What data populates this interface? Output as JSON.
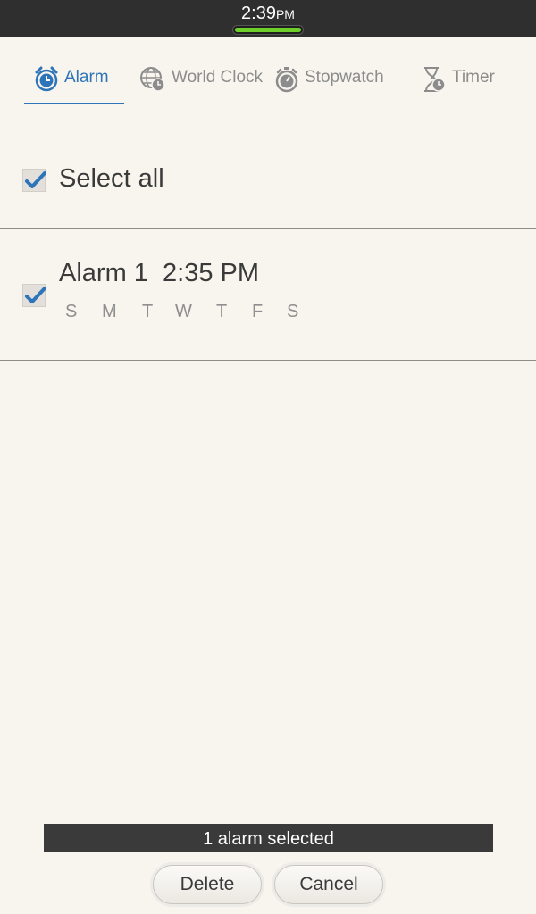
{
  "status_bar": {
    "time": "2:39",
    "ampm": "PM"
  },
  "tabs": [
    {
      "label": "Alarm",
      "icon": "alarm-clock-icon",
      "active": true
    },
    {
      "label": "World Clock",
      "icon": "globe-clock-icon",
      "active": false
    },
    {
      "label": "Stopwatch",
      "icon": "stopwatch-icon",
      "active": false
    },
    {
      "label": "Timer",
      "icon": "hourglass-icon",
      "active": false
    }
  ],
  "select_all": {
    "label": "Select all",
    "checked": true
  },
  "alarms": [
    {
      "title": "Alarm 1  2:35 PM",
      "checked": true,
      "days": [
        "S",
        "M",
        "T",
        "W",
        "T",
        "F",
        "S"
      ]
    }
  ],
  "selection_banner": "1 alarm selected",
  "buttons": {
    "delete": "Delete",
    "cancel": "Cancel"
  },
  "colors": {
    "accent": "#2e74b8",
    "background": "#f8f5ee",
    "status_bar": "#2f2f2f",
    "indicator": "#6fcf2a"
  }
}
